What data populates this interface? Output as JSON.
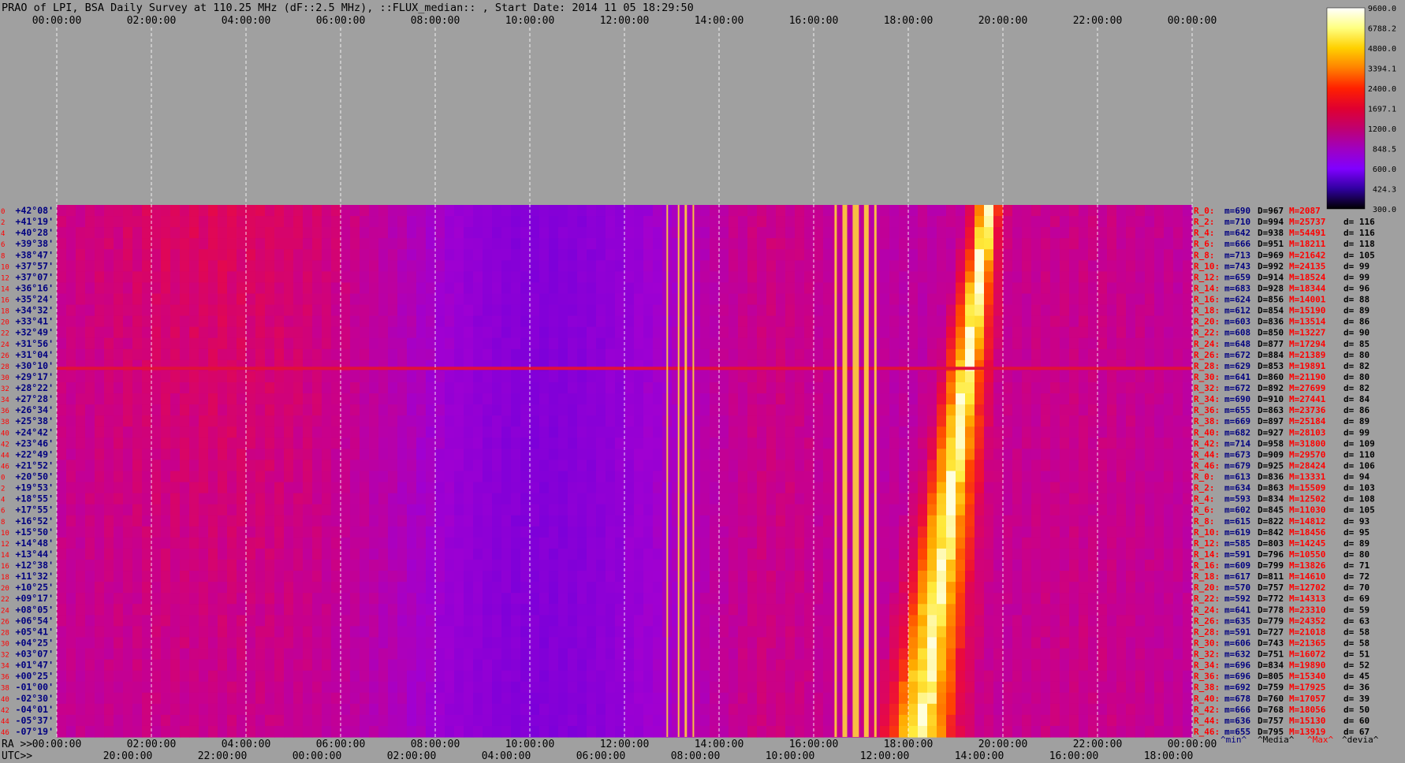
{
  "title": "PRAO of LPI, BSA Daily Survey at 110.25 MHz (dF::2.5 MHz), ::FLUX_median:: , Start Date: 2014 11 05 18:29:50",
  "chart_data": {
    "type": "heatmap",
    "title": "PRAO of LPI, BSA Daily Survey at 110.25 MHz (dF::2.5 MHz), ::FLUX_median:: , Start Date: 2014 11 05 18:29:50",
    "x_top_ticks": [
      "00:00:00",
      "02:00:00",
      "04:00:00",
      "06:00:00",
      "08:00:00",
      "10:00:00",
      "12:00:00",
      "14:00:00",
      "16:00:00",
      "18:00:00",
      "20:00:00",
      "22:00:00",
      "00:00:00"
    ],
    "x_ra_label": "RA >>",
    "x_ra_ticks": [
      "00:00:00",
      "02:00:00",
      "04:00:00",
      "06:00:00",
      "08:00:00",
      "10:00:00",
      "12:00:00",
      "14:00:00",
      "16:00:00",
      "18:00:00",
      "20:00:00",
      "22:00:00",
      "00:00:00"
    ],
    "x_utc_label": "UTC>>",
    "x_utc_ticks": [
      "20:00:00",
      "22:00:00",
      "00:00:00",
      "02:00:00",
      "04:00:00",
      "06:00:00",
      "08:00:00",
      "10:00:00",
      "12:00:00",
      "14:00:00",
      "16:00:00",
      "18:00:00"
    ],
    "decl_labels": [
      "+42°08'",
      "+41°19'",
      "+40°28'",
      "+39°38'",
      "+38°47'",
      "+37°57'",
      "+37°07'",
      "+36°16'",
      "+35°24'",
      "+34°32'",
      "+33°41'",
      "+32°49'",
      "+31°56'",
      "+31°04'",
      "+30°10'",
      "+29°17'",
      "+28°22'",
      "+27°28'",
      "+26°34'",
      "+25°38'",
      "+24°42'",
      "+23°46'",
      "+22°49'",
      "+21°52'",
      "+20°50'",
      "+19°53'",
      "+18°55'",
      "+17°55'",
      "+16°52'",
      "+15°50'",
      "+14°48'",
      "+13°44'",
      "+12°38'",
      "+11°32'",
      "+10°25'",
      "+09°17'",
      "+08°05'",
      "+06°54'",
      "+05°41'",
      "+04°25'",
      "+03°07'",
      "+01°47'",
      "+00°25'",
      "-01°00'",
      "-02°30'",
      "-04°01'",
      "-05°37'",
      "-07°19'"
    ],
    "row_numbers": [
      "0",
      "2",
      "4",
      "6",
      "8",
      "10",
      "12",
      "14",
      "16",
      "18",
      "20",
      "22",
      "24",
      "26",
      "28",
      "30",
      "32",
      "34",
      "36",
      "38",
      "40",
      "42",
      "44",
      "46",
      "0",
      "2",
      "4",
      "6",
      "8",
      "10",
      "12",
      "14",
      "16",
      "18",
      "20",
      "22",
      "24",
      "26",
      "28",
      "30",
      "32",
      "34",
      "36",
      "38",
      "40",
      "42",
      "44",
      "46"
    ],
    "colorbar": {
      "ticks": [
        "9600.0",
        "6788.2",
        "4800.0",
        "3394.1",
        "2400.0",
        "1697.1",
        "1200.0",
        "848.5",
        "600.0",
        "424.3",
        "300.0"
      ],
      "colors": [
        "#ffffff",
        "#ffff80",
        "#ffd000",
        "#ff8000",
        "#ff2000",
        "#e00030",
        "#c00070",
        "#a000c0",
        "#8000ff",
        "#3000a0",
        "#000000"
      ]
    },
    "stats_header": {
      "min": "^min^",
      "median": "^Media^",
      "max": "^Max^",
      "dev": "^devia^"
    },
    "stats": [
      {
        "r": "R_0:",
        "m": "m=690",
        "d": "D=967",
        "M": "M=2087",
        "dev": ""
      },
      {
        "r": "R_2:",
        "m": "m=710",
        "d": "D=994",
        "M": "M=25737",
        "dev": "d= 116"
      },
      {
        "r": "R_4:",
        "m": "m=642",
        "d": "D=938",
        "M": "M=54491",
        "dev": "d= 116"
      },
      {
        "r": "R_6:",
        "m": "m=666",
        "d": "D=951",
        "M": "M=18211",
        "dev": "d= 118"
      },
      {
        "r": "R_8:",
        "m": "m=713",
        "d": "D=969",
        "M": "M=21642",
        "dev": "d= 105"
      },
      {
        "r": "R_10:",
        "m": "m=743",
        "d": "D=992",
        "M": "M=24135",
        "dev": "d= 99"
      },
      {
        "r": "R_12:",
        "m": "m=659",
        "d": "D=914",
        "M": "M=18524",
        "dev": "d= 99"
      },
      {
        "r": "R_14:",
        "m": "m=683",
        "d": "D=928",
        "M": "M=18344",
        "dev": "d= 96"
      },
      {
        "r": "R_16:",
        "m": "m=624",
        "d": "D=856",
        "M": "M=14001",
        "dev": "d= 88"
      },
      {
        "r": "R_18:",
        "m": "m=612",
        "d": "D=854",
        "M": "M=15190",
        "dev": "d= 89"
      },
      {
        "r": "R_20:",
        "m": "m=603",
        "d": "D=836",
        "M": "M=13514",
        "dev": "d= 86"
      },
      {
        "r": "R_22:",
        "m": "m=608",
        "d": "D=850",
        "M": "M=13227",
        "dev": "d= 90"
      },
      {
        "r": "R_24:",
        "m": "m=648",
        "d": "D=877",
        "M": "M=17294",
        "dev": "d= 85"
      },
      {
        "r": "R_26:",
        "m": "m=672",
        "d": "D=884",
        "M": "M=21389",
        "dev": "d= 80"
      },
      {
        "r": "R_28:",
        "m": "m=629",
        "d": "D=853",
        "M": "M=19891",
        "dev": "d= 82"
      },
      {
        "r": "R_30:",
        "m": "m=641",
        "d": "D=860",
        "M": "M=21190",
        "dev": "d= 80"
      },
      {
        "r": "R_32:",
        "m": "m=672",
        "d": "D=892",
        "M": "M=27699",
        "dev": "d= 82"
      },
      {
        "r": "R_34:",
        "m": "m=690",
        "d": "D=910",
        "M": "M=27441",
        "dev": "d= 84"
      },
      {
        "r": "R_36:",
        "m": "m=655",
        "d": "D=863",
        "M": "M=23736",
        "dev": "d= 86"
      },
      {
        "r": "R_38:",
        "m": "m=669",
        "d": "D=897",
        "M": "M=25184",
        "dev": "d= 89"
      },
      {
        "r": "R_40:",
        "m": "m=682",
        "d": "D=927",
        "M": "M=28103",
        "dev": "d= 99"
      },
      {
        "r": "R_42:",
        "m": "m=714",
        "d": "D=958",
        "M": "M=31800",
        "dev": "d= 109"
      },
      {
        "r": "R_44:",
        "m": "m=673",
        "d": "D=909",
        "M": "M=29570",
        "dev": "d= 110"
      },
      {
        "r": "R_46:",
        "m": "m=679",
        "d": "D=925",
        "M": "M=28424",
        "dev": "d= 106"
      },
      {
        "r": "R_0:",
        "m": "m=613",
        "d": "D=836",
        "M": "M=13331",
        "dev": "d= 94"
      },
      {
        "r": "R_2:",
        "m": "m=634",
        "d": "D=863",
        "M": "M=15509",
        "dev": "d= 103"
      },
      {
        "r": "R_4:",
        "m": "m=593",
        "d": "D=834",
        "M": "M=12502",
        "dev": "d= 108"
      },
      {
        "r": "R_6:",
        "m": "m=602",
        "d": "D=845",
        "M": "M=11030",
        "dev": "d= 105"
      },
      {
        "r": "R_8:",
        "m": "m=615",
        "d": "D=822",
        "M": "M=14812",
        "dev": "d= 93"
      },
      {
        "r": "R_10:",
        "m": "m=619",
        "d": "D=842",
        "M": "M=18456",
        "dev": "d= 95"
      },
      {
        "r": "R_12:",
        "m": "m=585",
        "d": "D=803",
        "M": "M=14245",
        "dev": "d= 89"
      },
      {
        "r": "R_14:",
        "m": "m=591",
        "d": "D=796",
        "M": "M=10550",
        "dev": "d= 80"
      },
      {
        "r": "R_16:",
        "m": "m=609",
        "d": "D=799",
        "M": "M=13826",
        "dev": "d= 71"
      },
      {
        "r": "R_18:",
        "m": "m=617",
        "d": "D=811",
        "M": "M=14610",
        "dev": "d= 72"
      },
      {
        "r": "R_20:",
        "m": "m=570",
        "d": "D=757",
        "M": "M=12702",
        "dev": "d= 70"
      },
      {
        "r": "R_22:",
        "m": "m=592",
        "d": "D=772",
        "M": "M=14313",
        "dev": "d= 69"
      },
      {
        "r": "R_24:",
        "m": "m=641",
        "d": "D=778",
        "M": "M=23310",
        "dev": "d= 59"
      },
      {
        "r": "R_26:",
        "m": "m=635",
        "d": "D=779",
        "M": "M=24352",
        "dev": "d= 63"
      },
      {
        "r": "R_28:",
        "m": "m=591",
        "d": "D=727",
        "M": "M=21018",
        "dev": "d= 58"
      },
      {
        "r": "R_30:",
        "m": "m=606",
        "d": "D=743",
        "M": "M=21365",
        "dev": "d= 58"
      },
      {
        "r": "R_32:",
        "m": "m=632",
        "d": "D=751",
        "M": "M=16072",
        "dev": "d= 51"
      },
      {
        "r": "R_34:",
        "m": "m=696",
        "d": "D=834",
        "M": "M=19890",
        "dev": "d= 52"
      },
      {
        "r": "R_36:",
        "m": "m=696",
        "d": "D=805",
        "M": "M=15340",
        "dev": "d= 45"
      },
      {
        "r": "R_38:",
        "m": "m=692",
        "d": "D=759",
        "M": "M=17925",
        "dev": "d= 36"
      },
      {
        "r": "R_40:",
        "m": "m=678",
        "d": "D=760",
        "M": "M=17057",
        "dev": "d= 39"
      },
      {
        "r": "R_42:",
        "m": "m=666",
        "d": "D=768",
        "M": "M=18056",
        "dev": "d= 50"
      },
      {
        "r": "R_44:",
        "m": "m=636",
        "d": "D=757",
        "M": "M=15130",
        "dev": "d= 60"
      },
      {
        "r": "R_46:",
        "m": "m=655",
        "d": "D=795",
        "M": "M=13919",
        "dev": "d= 67"
      }
    ],
    "colors": {
      "background": "#a0a0a0",
      "grid": "#ffffff",
      "decl_text": "#000080",
      "row_number": "#ff0000",
      "stat_r": "#ff0000",
      "stat_m": "#000080",
      "stat_d": "#000000",
      "stat_M": "#ff0000",
      "stat_dev": "#000000"
    }
  }
}
